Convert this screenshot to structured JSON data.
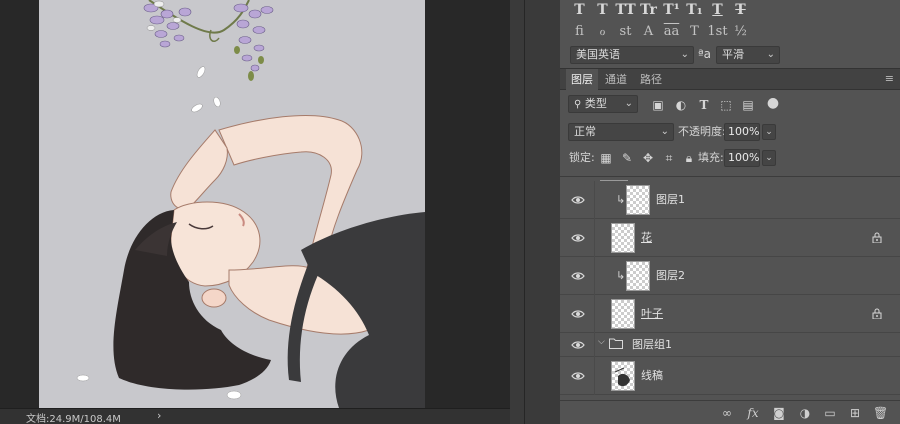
{
  "status": {
    "document_size": "文档:24.9M/108.4M",
    "arrow": "›"
  },
  "character": {
    "row1_glyphs": [
      "T",
      "T",
      "TT",
      "Tr",
      "T¹",
      "T₁",
      "T",
      "T"
    ],
    "row2_glyphs": [
      "ﬁ",
      "ℴ",
      "st",
      "A",
      "aa",
      "T",
      "1st",
      "½"
    ],
    "language": "美国英语",
    "aa_icon": "ªa",
    "antialias": "平滑"
  },
  "tabs": [
    "图层",
    "通道",
    "路径"
  ],
  "filter": {
    "kind_label": "类型"
  },
  "blend": {
    "mode": "正常",
    "opacity_label": "不透明度:",
    "opacity": "100%"
  },
  "lock": {
    "lock_label": "锁定:",
    "fill_label": "填充:",
    "fill": "100%"
  },
  "layers": [
    {
      "name": "图层1",
      "clipped": true,
      "locked": false,
      "underline": false
    },
    {
      "name": "花",
      "clipped": false,
      "locked": true,
      "underline": true
    },
    {
      "name": "图层2",
      "clipped": true,
      "locked": false,
      "underline": false
    },
    {
      "name": "叶子",
      "clipped": false,
      "locked": true,
      "underline": true
    },
    {
      "name": "图层组1",
      "group": true
    },
    {
      "name": "线稿",
      "clipped": false,
      "locked": false,
      "underline": false
    }
  ],
  "colors": {
    "panel": "#535353",
    "canvas_bg": "#c8c8cc",
    "workspace": "#282828"
  }
}
